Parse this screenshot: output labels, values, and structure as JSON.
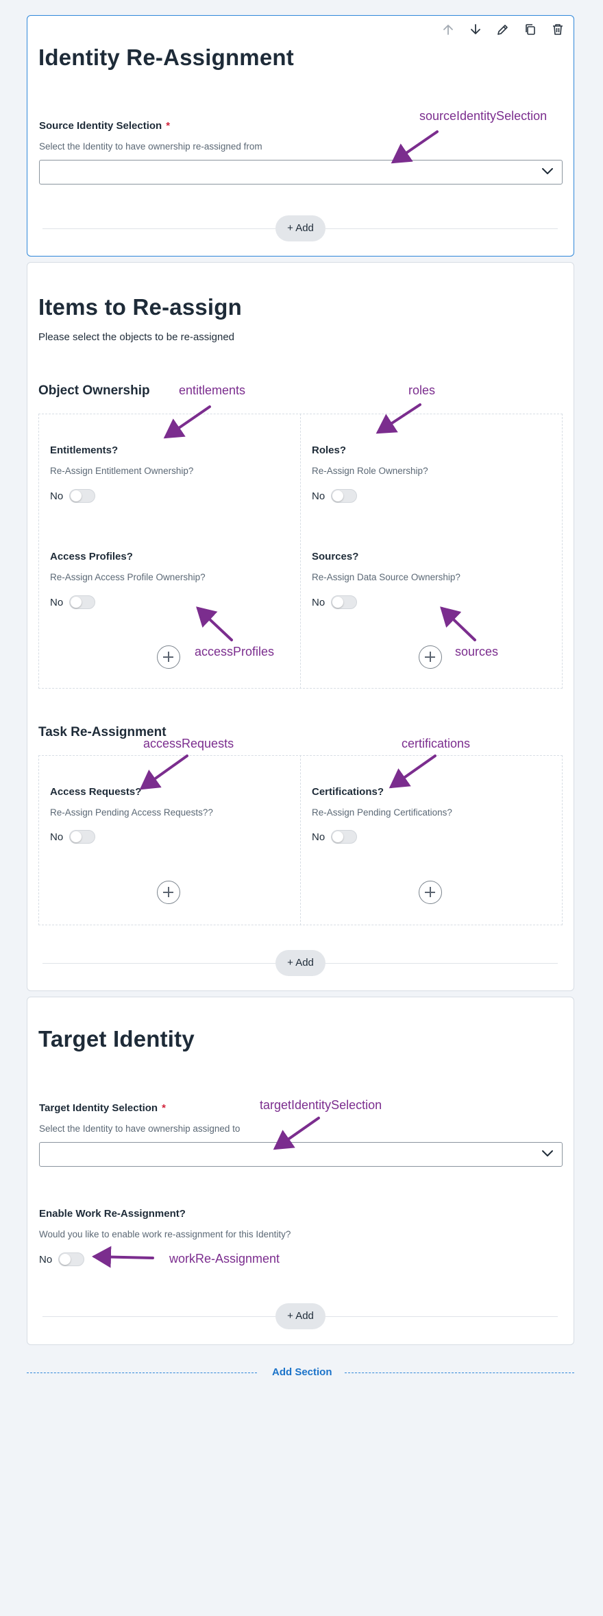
{
  "sections": {
    "identity_reassignment": {
      "title": "Identity Re-Assignment",
      "source_field": {
        "label": "Source Identity Selection",
        "required_mark": "*",
        "help": "Select the Identity to have ownership re-assigned from",
        "value": ""
      },
      "add_label": "+ Add"
    },
    "items": {
      "title": "Items to Re-assign",
      "description": "Please select the objects to be re-assigned",
      "object_ownership": {
        "title": "Object Ownership",
        "toggles": [
          {
            "title": "Entitlements?",
            "help": "Re-Assign Entitlement Ownership?",
            "value_label": "No",
            "on": false
          },
          {
            "title": "Roles?",
            "help": "Re-Assign Role Ownership?",
            "value_label": "No",
            "on": false
          },
          {
            "title": "Access Profiles?",
            "help": "Re-Assign Access Profile Ownership?",
            "value_label": "No",
            "on": false
          },
          {
            "title": "Sources?",
            "help": "Re-Assign Data Source Ownership?",
            "value_label": "No",
            "on": false
          }
        ]
      },
      "task_reassignment": {
        "title": "Task Re-Assignment",
        "toggles": [
          {
            "title": "Access Requests?",
            "help": "Re-Assign Pending Access Requests??",
            "value_label": "No",
            "on": false
          },
          {
            "title": "Certifications?",
            "help": "Re-Assign Pending Certifications?",
            "value_label": "No",
            "on": false
          }
        ]
      },
      "add_label": "+ Add"
    },
    "target": {
      "title": "Target Identity",
      "target_field": {
        "label": "Target Identity Selection",
        "required_mark": "*",
        "help": "Select the Identity to have ownership assigned to",
        "value": ""
      },
      "work_toggle": {
        "title": "Enable Work Re-Assignment?",
        "help": "Would you like to enable work re-assignment for this Identity?",
        "value_label": "No",
        "on": false
      },
      "add_label": "+ Add"
    }
  },
  "add_section_label": "Add Section",
  "annotations": {
    "sourceIdentitySelection": "sourceIdentitySelection",
    "entitlements": "entitlements",
    "roles": "roles",
    "accessProfiles": "accessProfiles",
    "sources": "sources",
    "accessRequests": "accessRequests",
    "certifications": "certifications",
    "targetIdentitySelection": "targetIdentitySelection",
    "workReAssignment": "workRe-Assignment"
  },
  "toolbar_icons": [
    "arrow-up-icon",
    "arrow-down-icon",
    "pencil-icon",
    "copy-icon",
    "trash-icon"
  ],
  "colors": {
    "accent": "#2f87d9",
    "annotation": "#7b2d8e",
    "required": "#d1233b",
    "link": "#1b73c9"
  }
}
